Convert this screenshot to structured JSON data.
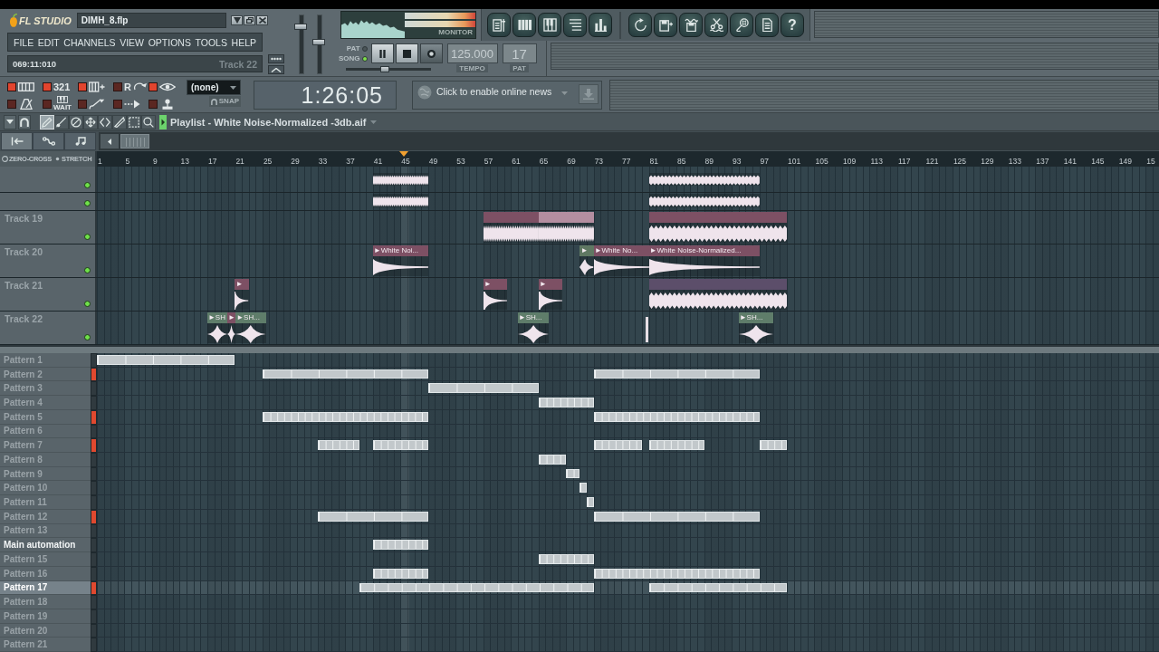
{
  "app": {
    "logo": "FL STUDIO",
    "file": "DIMH_8.flp"
  },
  "menu": [
    "FILE",
    "EDIT",
    "CHANNELS",
    "VIEW",
    "OPTIONS",
    "TOOLS",
    "HELP"
  ],
  "hint_bar": {
    "position": "069:11:010",
    "target": "Track 22"
  },
  "volume_slider": {
    "level": 0.84
  },
  "pitch_slider": {
    "level": 0.55
  },
  "monitor": {
    "label": "MONITOR"
  },
  "toolbar": {
    "help": "?"
  },
  "transport": {
    "modes": [
      {
        "label": "PAT",
        "selected": false
      },
      {
        "label": "SONG",
        "selected": true
      }
    ],
    "tempo": "125.000",
    "tempo_label": "TEMPO",
    "pattern": "17",
    "pattern_label": "PAT",
    "position": {
      "level": 0.45
    }
  },
  "record_toggles": [
    {
      "on": true
    },
    {
      "on": true,
      "label": "321"
    },
    {
      "on": true
    },
    {
      "on": false,
      "label": "R"
    },
    {
      "on": true
    },
    {
      "on": false
    },
    {
      "on": false,
      "label": "WAIT"
    },
    {
      "on": false
    },
    {
      "on": false
    },
    {
      "on": false
    }
  ],
  "snap": {
    "value": "(none)",
    "label": "SNAP"
  },
  "song_position": "1:26:05",
  "news": {
    "text": "Click to enable online news"
  },
  "playlist": {
    "title": "Playlist - White Noise-Normalized -3db.aif",
    "tools": [
      {
        "selected": true
      },
      {
        "selected": false
      },
      {
        "selected": false
      },
      {
        "selected": false
      },
      {
        "selected": false
      },
      {
        "selected": false
      },
      {
        "selected": false
      },
      {
        "selected": false
      }
    ],
    "view_tabs": [
      {
        "selected": true
      },
      {
        "selected": false
      },
      {
        "selected": false
      }
    ],
    "options": [
      "ZERO-CROSS",
      "STRETCH"
    ],
    "ruler": [
      "1",
      "5",
      "9",
      "13",
      "17",
      "21",
      "25",
      "29",
      "33",
      "37",
      "41",
      "45",
      "49",
      "53",
      "57",
      "61",
      "65",
      "69",
      "73",
      "77",
      "81",
      "85",
      "89",
      "93",
      "97",
      "101",
      "105",
      "109",
      "113",
      "117",
      "121",
      "125",
      "129",
      "133",
      "137",
      "141",
      "145",
      "149",
      "15"
    ],
    "tracks": [
      {
        "enabled": true,
        "clips": [
          {
            "kind": "noise"
          },
          {
            "kind": "noise"
          }
        ]
      },
      {
        "enabled": true,
        "clips": [
          {
            "kind": "noise"
          },
          {
            "kind": "noise"
          }
        ]
      },
      {
        "name": "Track 19",
        "enabled": true,
        "clips": [
          {
            "kind": "noise",
            "color": "#7d5064"
          },
          {
            "kind": "noise",
            "color": "#b48ea0"
          },
          {
            "kind": "noise",
            "color": "#7d5064"
          }
        ]
      },
      {
        "name": "Track 20",
        "enabled": true,
        "clips": [
          {
            "kind": "fade",
            "color": "#7d5064",
            "label": "►White Noi..."
          },
          {
            "kind": "rise",
            "color": "#5f7862",
            "label": "►"
          },
          {
            "kind": "fade",
            "color": "#7d5064",
            "label": "►White No..."
          },
          {
            "kind": "fade",
            "color": "#7d5064",
            "label": "►White Noise-Normalized..."
          }
        ]
      },
      {
        "name": "Track 21",
        "enabled": true,
        "clips": [
          {
            "kind": "hit",
            "color": "#7d5064",
            "label": "►"
          },
          {
            "kind": "hit",
            "color": "#7d5064",
            "label": "►"
          },
          {
            "kind": "hit",
            "color": "#7d5064",
            "label": "►"
          },
          {
            "kind": "noise",
            "color": "#5c4e6a"
          }
        ]
      },
      {
        "name": "Track 22",
        "enabled": true,
        "clips": [
          {
            "kind": "swell",
            "color": "#5f7d6a",
            "label": "►SH"
          },
          {
            "kind": "swell",
            "color": "#7d5064",
            "label": "►"
          },
          {
            "kind": "swell",
            "color": "#5f7d6a",
            "label": "►SH..."
          },
          {
            "kind": "swell",
            "color": "#5f7d6a",
            "label": "►SH..."
          },
          {
            "kind": "sliver"
          },
          {
            "kind": "swell",
            "color": "#5f7d6a",
            "label": "►SH..."
          }
        ]
      }
    ]
  },
  "patterns": [
    {
      "name": "Pattern 1",
      "kind": "pattern",
      "selected": false,
      "marked": false
    },
    {
      "name": "Pattern 2",
      "kind": "pattern",
      "selected": false,
      "marked": true
    },
    {
      "name": "Pattern 3",
      "kind": "pattern",
      "selected": false,
      "marked": false
    },
    {
      "name": "Pattern 4",
      "kind": "pattern",
      "selected": false,
      "marked": false
    },
    {
      "name": "Pattern 5",
      "kind": "pattern",
      "selected": false,
      "marked": true
    },
    {
      "name": "Pattern 6",
      "kind": "pattern",
      "selected": false,
      "marked": false
    },
    {
      "name": "Pattern 7",
      "kind": "pattern",
      "selected": false,
      "marked": true
    },
    {
      "name": "Pattern 8",
      "kind": "pattern",
      "selected": false,
      "marked": false
    },
    {
      "name": "Pattern 9",
      "kind": "pattern",
      "selected": false,
      "marked": false
    },
    {
      "name": "Pattern 10",
      "kind": "pattern",
      "selected": false,
      "marked": false
    },
    {
      "name": "Pattern 11",
      "kind": "pattern",
      "selected": false,
      "marked": false
    },
    {
      "name": "Pattern 12",
      "kind": "pattern",
      "selected": false,
      "marked": true
    },
    {
      "name": "Pattern 13",
      "kind": "pattern",
      "selected": false,
      "marked": false
    },
    {
      "name": "Main automation",
      "kind": "automation",
      "selected": false,
      "marked": false
    },
    {
      "name": "Pattern 15",
      "kind": "pattern",
      "selected": false,
      "marked": false
    },
    {
      "name": "Pattern 16",
      "kind": "pattern",
      "selected": false,
      "marked": false
    },
    {
      "name": "Pattern 17",
      "kind": "pattern",
      "selected": true,
      "marked": true
    },
    {
      "name": "Pattern 18",
      "kind": "pattern",
      "selected": false,
      "marked": false
    },
    {
      "name": "Pattern 19",
      "kind": "pattern",
      "selected": false,
      "marked": false
    },
    {
      "name": "Pattern 20",
      "kind": "pattern",
      "selected": false,
      "marked": false
    },
    {
      "name": "Pattern 21",
      "kind": "pattern",
      "selected": false,
      "marked": false
    }
  ]
}
